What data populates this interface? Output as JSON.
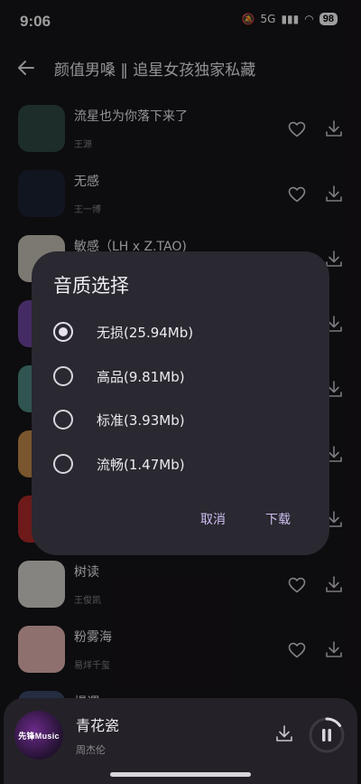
{
  "status_bar": {
    "time": "9:06",
    "network": "5G",
    "battery": "98"
  },
  "header": {
    "title": "颜值男嗓 ‖ 追星女孩独家私藏"
  },
  "songs": [
    {
      "title": "流星也为你落下来了",
      "artist": "王源",
      "cover_color": "#2f4a43"
    },
    {
      "title": "无感",
      "artist": "王一博",
      "cover_color": "#1c2233"
    },
    {
      "title": "敏感（LH x Z.TAO)",
      "artist": "",
      "cover_color": "#c9c3b8"
    },
    {
      "title": "",
      "artist": "",
      "cover_color": "#6f46a0"
    },
    {
      "title": "",
      "artist": "",
      "cover_color": "#4e8a82"
    },
    {
      "title": "",
      "artist": "",
      "cover_color": "#c38b4a"
    },
    {
      "title": "",
      "artist": "",
      "cover_color": "#b22a2a"
    },
    {
      "title": "树读",
      "artist": "王俊凯",
      "cover_color": "#d8d5d0"
    },
    {
      "title": "粉雾海",
      "artist": "易烊千玺",
      "cover_color": "#e6b7b4"
    },
    {
      "title": "榻谓",
      "artist": "",
      "cover_color": "#3a4a6a"
    }
  ],
  "dialog": {
    "title": "音质选择",
    "options": [
      {
        "label": "无损(25.94Mb)",
        "selected": true
      },
      {
        "label": "高品(9.81Mb)",
        "selected": false
      },
      {
        "label": "标准(3.93Mb)",
        "selected": false
      },
      {
        "label": "流畅(1.47Mb)",
        "selected": false
      }
    ],
    "cancel_label": "取消",
    "confirm_label": "下载"
  },
  "player": {
    "cover_text": "先锋Music",
    "title": "青花瓷",
    "artist": "周杰伦",
    "progress": 0.15
  },
  "colors": {
    "accent": "#cdbef2",
    "background": "#161417",
    "dialog": "#2a2830"
  }
}
